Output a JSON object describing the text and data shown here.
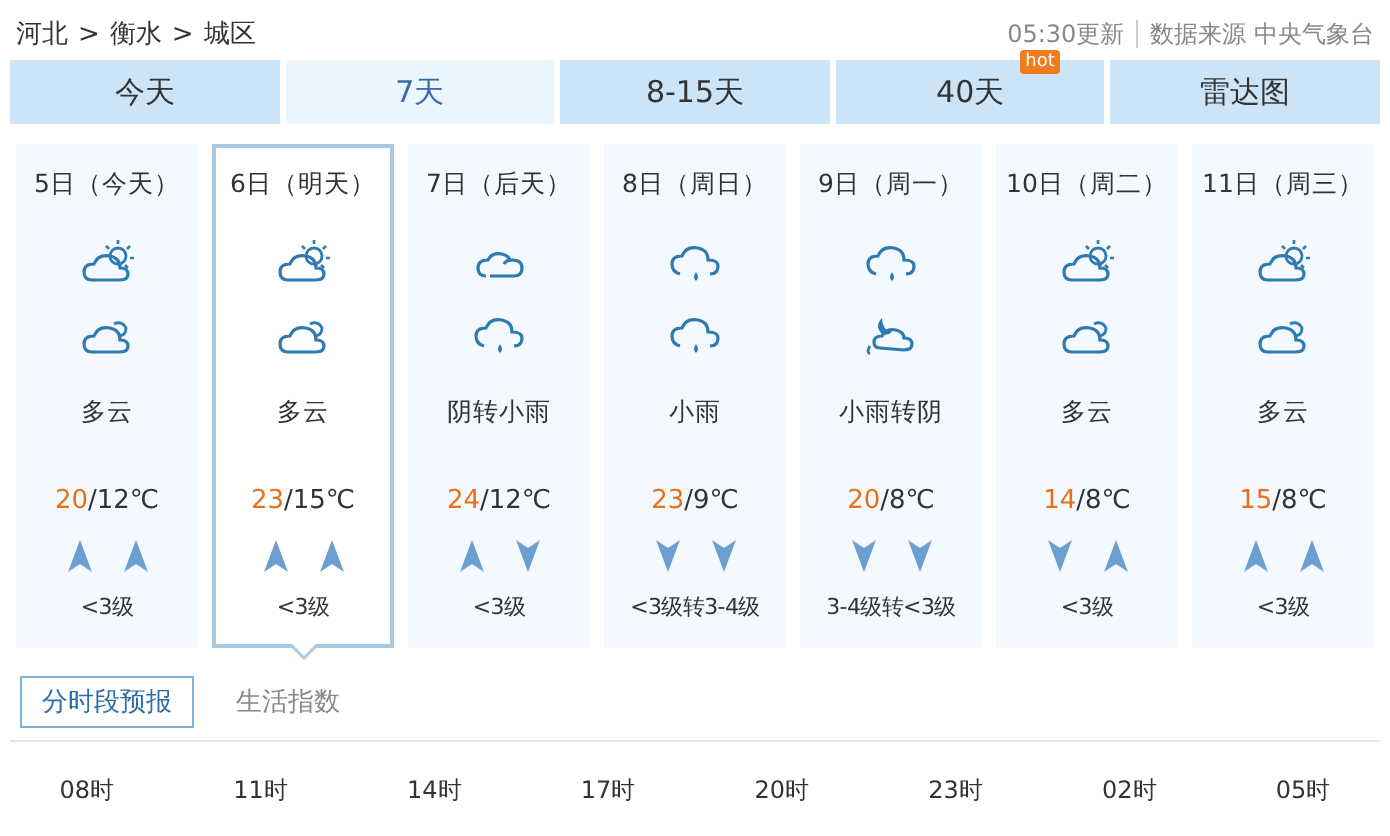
{
  "breadcrumb": [
    "河北",
    "衡水",
    "城区"
  ],
  "breadcrumb_separator": ">",
  "update_time": "05:30更新",
  "source": "数据来源 中央气象台",
  "tabs": [
    {
      "label": "今天",
      "selected": false
    },
    {
      "label": "7天",
      "selected": true
    },
    {
      "label": "8-15天",
      "selected": false
    },
    {
      "label": "40天",
      "selected": false,
      "badge": "hot"
    },
    {
      "label": "雷达图",
      "selected": false
    }
  ],
  "days": [
    {
      "date": "5日（今天）",
      "icons": [
        {
          "kind": "sun_cloud"
        },
        {
          "kind": "moon_cloud"
        }
      ],
      "weather": "多云",
      "high": "20",
      "low": "/12℃",
      "wind_arrows": [
        {
          "kind": "up"
        },
        {
          "kind": "up"
        }
      ],
      "wind": "<3级",
      "selected": false
    },
    {
      "date": "6日（明天）",
      "icons": [
        {
          "kind": "sun_cloud"
        },
        {
          "kind": "moon_cloud"
        }
      ],
      "weather": "多云",
      "high": "23",
      "low": "/15℃",
      "wind_arrows": [
        {
          "kind": "up"
        },
        {
          "kind": "up"
        }
      ],
      "wind": "<3级",
      "selected": true
    },
    {
      "date": "7日（后天）",
      "icons": [
        {
          "kind": "cloud"
        },
        {
          "kind": "rain"
        }
      ],
      "weather": "阴转小雨",
      "high": "24",
      "low": "/12℃",
      "wind_arrows": [
        {
          "kind": "up"
        },
        {
          "kind": "down"
        }
      ],
      "wind": "<3级",
      "selected": false
    },
    {
      "date": "8日（周日）",
      "icons": [
        {
          "kind": "rain"
        },
        {
          "kind": "rain"
        }
      ],
      "weather": "小雨",
      "high": "23",
      "low": "/9℃",
      "wind_arrows": [
        {
          "kind": "down"
        },
        {
          "kind": "down"
        }
      ],
      "wind": "<3级转3-4级",
      "selected": false
    },
    {
      "date": "9日（周一）",
      "icons": [
        {
          "kind": "rain"
        },
        {
          "kind": "moon_overcast"
        }
      ],
      "weather": "小雨转阴",
      "high": "20",
      "low": "/8℃",
      "wind_arrows": [
        {
          "kind": "down"
        },
        {
          "kind": "down"
        }
      ],
      "wind": "3-4级转<3级",
      "selected": false
    },
    {
      "date": "10日（周二）",
      "icons": [
        {
          "kind": "sun_cloud"
        },
        {
          "kind": "moon_cloud"
        }
      ],
      "weather": "多云",
      "high": "14",
      "low": "/8℃",
      "wind_arrows": [
        {
          "kind": "down"
        },
        {
          "kind": "up"
        }
      ],
      "wind": "<3级",
      "selected": false
    },
    {
      "date": "11日（周三）",
      "icons": [
        {
          "kind": "sun_cloud"
        },
        {
          "kind": "moon_cloud"
        }
      ],
      "weather": "多云",
      "high": "15",
      "low": "/8℃",
      "wind_arrows": [
        {
          "kind": "up"
        },
        {
          "kind": "up"
        }
      ],
      "wind": "<3级",
      "selected": false
    }
  ],
  "sub_tabs": [
    {
      "label": "分时段预报",
      "selected": true
    },
    {
      "label": "生活指数",
      "selected": false
    }
  ],
  "hours": [
    "08时",
    "11时",
    "14时",
    "17时",
    "20时",
    "23时",
    "02时",
    "05时"
  ]
}
